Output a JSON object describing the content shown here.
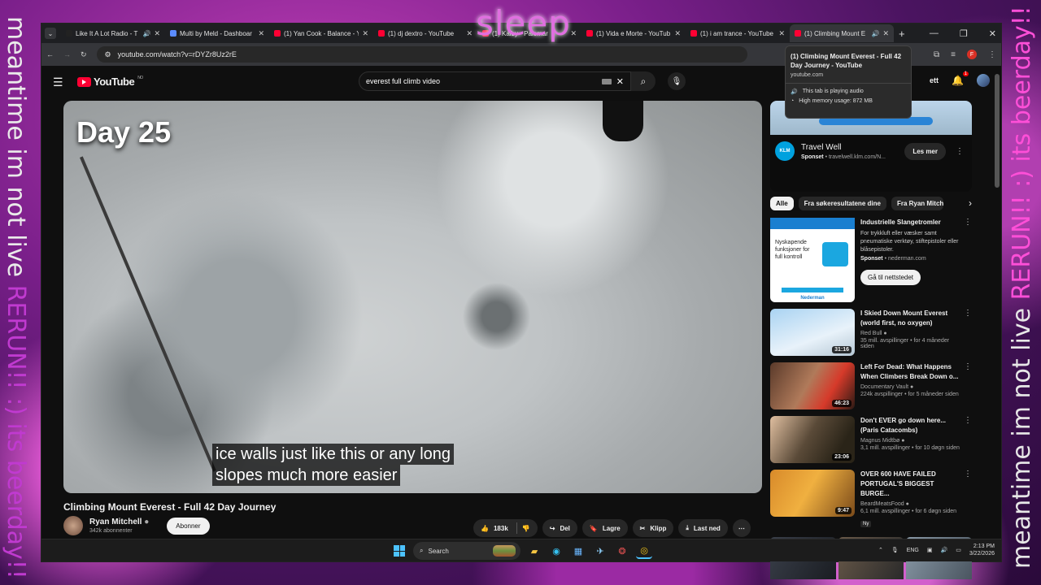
{
  "overlay": {
    "left_line1": "meantime im not live ",
    "left_rerun": "RERUN!! :) its beerday!!",
    "right_line1": "meantime im not live ",
    "right_rerun": "RERUN!! :) its beerday!!",
    "sleep": "sleep"
  },
  "browser": {
    "tabs": [
      {
        "title": "Like It A Lot Radio - T",
        "icon_color": "#222222",
        "audio": true
      },
      {
        "title": "Multi by Meld - Dashboar",
        "icon_color": "#5b8cff",
        "audio": false
      },
      {
        "title": "(1) Yan Cook - Balance - Y",
        "icon_color": "#ff0033",
        "audio": false
      },
      {
        "title": "(1) dj dextro - YouTube",
        "icon_color": "#ff0033",
        "audio": false
      },
      {
        "title": "(1) Kaiby - Palomar",
        "icon_color": "#ff0033",
        "audio": false
      },
      {
        "title": "(1) Vida e Morte - YouTub",
        "icon_color": "#ff0033",
        "audio": false
      },
      {
        "title": "(1) i am trance - YouTube",
        "icon_color": "#ff0033",
        "audio": false
      },
      {
        "title": "(1) Climbing Mount E",
        "icon_color": "#ff0033",
        "audio": true,
        "active": true
      }
    ],
    "close_glyph": "✕",
    "new_tab": "+",
    "url": "youtube.com/watch?v=rDYZr8Uz2rE"
  },
  "tooltip": {
    "title": "(1) Climbing Mount Everest - Full 42 Day Journey - YouTube",
    "url": "youtube.com",
    "audio": "This tab is playing audio",
    "memory": "High memory usage: 872 MB"
  },
  "youtube": {
    "logo": "YouTube",
    "region": "NO",
    "search_query": "everest full climb video",
    "create_label": "ett",
    "notif_count": "1"
  },
  "video": {
    "overlay_day": "Day 25",
    "caption_line1": "ice walls just like this or any long",
    "caption_line2": "slopes much more easier",
    "title": "Climbing Mount Everest - Full 42 Day Journey",
    "channel": "Ryan Mitchell",
    "subs": "342k abonnenter",
    "subscribe": "Abonner",
    "likes": "183k",
    "share": "Del",
    "save": "Lagre",
    "clip": "Klipp",
    "download": "Last ned"
  },
  "sidebar": {
    "ad": {
      "logo": "KLM",
      "title": "Travel Well",
      "sponsored": "Sponset",
      "domain": "travelwell.klm.com/N...",
      "button": "Les mer"
    },
    "chips": [
      "Alle",
      "Fra søkeresultatene dine",
      "Fra Ryan Mitch"
    ],
    "ad2": {
      "title": "Industrielle Slangetromler",
      "desc": "For trykkluft eller væsker samt pneumatiske verktøy, stiftepistoler eller blåsepistoler.",
      "sponsored": "Sponset",
      "domain": "nederman.com",
      "button": "Gå til nettstedet",
      "thumb_text": "Nyskapende funksjoner for full kontroll",
      "brand": "Nederman"
    },
    "videos": [
      {
        "title": "I Skied Down Mount Everest (world first, no oxygen)",
        "channel": "Red Bull",
        "views": "35 mill. avspillinger • for 4 måneder siden",
        "duration": "31:16",
        "thumb": "linear-gradient(160deg,#a9d3f2,#e8f2fa 60%,#b5c7d4)"
      },
      {
        "title": "Left For Dead: What Happens When Climbers Break Down o...",
        "channel": "Documentary Vault",
        "views": "224k avspillinger • for 5 måneder siden",
        "duration": "46:23",
        "thumb": "linear-gradient(120deg,#5a3a2a,#b07a5a 45%,#d63a2a 70%,#2a1a14)"
      },
      {
        "title": "Don't EVER go down here... (Paris Catacombs)",
        "channel": "Magnus Midtbø",
        "views": "3,1 mill. avspillinger • for 10 døgn siden",
        "duration": "23:06",
        "thumb": "linear-gradient(120deg,#e0bfa0,#5a4a38 45%,#2a2418 80%)"
      },
      {
        "title": "OVER 600 HAVE FAILED PORTUGAL'S BIGGEST BURGE...",
        "channel": "BeardMeatsFood",
        "views": "6,1 mill. avspillinger • for 6 døgn siden",
        "duration": "9:47",
        "thumb": "linear-gradient(120deg,#d88a2a,#f0b040 45%,#7a4a1a)",
        "badge": "Ny"
      }
    ]
  },
  "taskbar": {
    "search": "Search",
    "lang": "ENG",
    "time": "2:13 PM",
    "date": "3/22/2026"
  }
}
